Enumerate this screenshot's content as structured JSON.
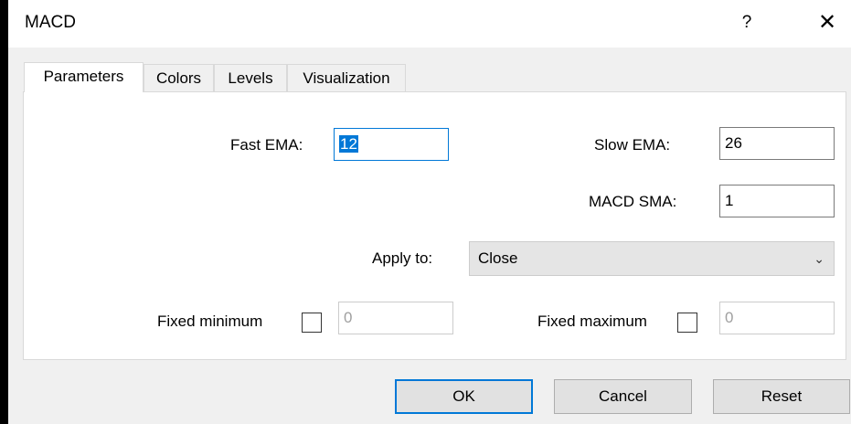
{
  "window": {
    "title": "MACD",
    "help_label": "?",
    "close_label": "✕"
  },
  "tabs": [
    {
      "label": "Parameters",
      "active": true
    },
    {
      "label": "Colors",
      "active": false
    },
    {
      "label": "Levels",
      "active": false
    },
    {
      "label": "Visualization",
      "active": false
    }
  ],
  "params": {
    "fast_ema_label": "Fast EMA:",
    "fast_ema_value": "12",
    "slow_ema_label": "Slow EMA:",
    "slow_ema_value": "26",
    "macd_sma_label": "MACD SMA:",
    "macd_sma_value": "1",
    "apply_to_label": "Apply to:",
    "apply_to_value": "Close",
    "fixed_min_label": "Fixed minimum",
    "fixed_min_value": "0",
    "fixed_max_label": "Fixed maximum",
    "fixed_max_value": "0"
  },
  "buttons": {
    "ok": "OK",
    "cancel": "Cancel",
    "reset": "Reset"
  },
  "colors": {
    "accent": "#0078d7",
    "window_bg": "#f0f0f0",
    "panel_bg": "#ffffff"
  }
}
